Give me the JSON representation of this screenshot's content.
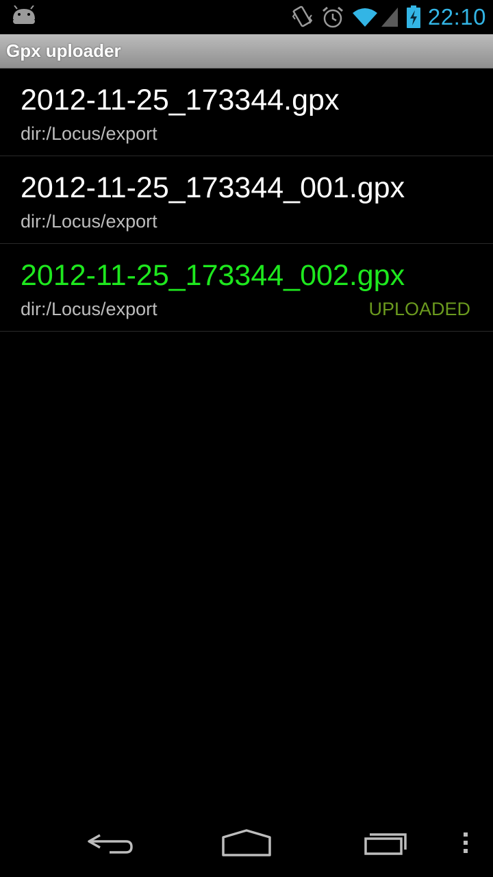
{
  "status_bar": {
    "time": "22:10",
    "icons": [
      "android-notification-icon",
      "vibrate-icon",
      "alarm-icon",
      "wifi-icon",
      "signal-icon",
      "battery-charging-icon"
    ],
    "clock_color": "#33b5e5"
  },
  "app": {
    "title": "Gpx uploader"
  },
  "files": [
    {
      "name": "2012-11-25_173344.gpx",
      "dir": "dir:/Locus/export",
      "status": ""
    },
    {
      "name": "2012-11-25_173344_001.gpx",
      "dir": "dir:/Locus/export",
      "status": ""
    },
    {
      "name": "2012-11-25_173344_002.gpx",
      "dir": "dir:/Locus/export",
      "status": "UPLOADED"
    }
  ],
  "colors": {
    "uploaded_name": "#1ee81e",
    "uploaded_status": "#6b9a1e"
  },
  "nav_bar": {
    "icons": [
      "back-icon",
      "home-icon",
      "recent-apps-icon",
      "overflow-menu-icon"
    ]
  }
}
